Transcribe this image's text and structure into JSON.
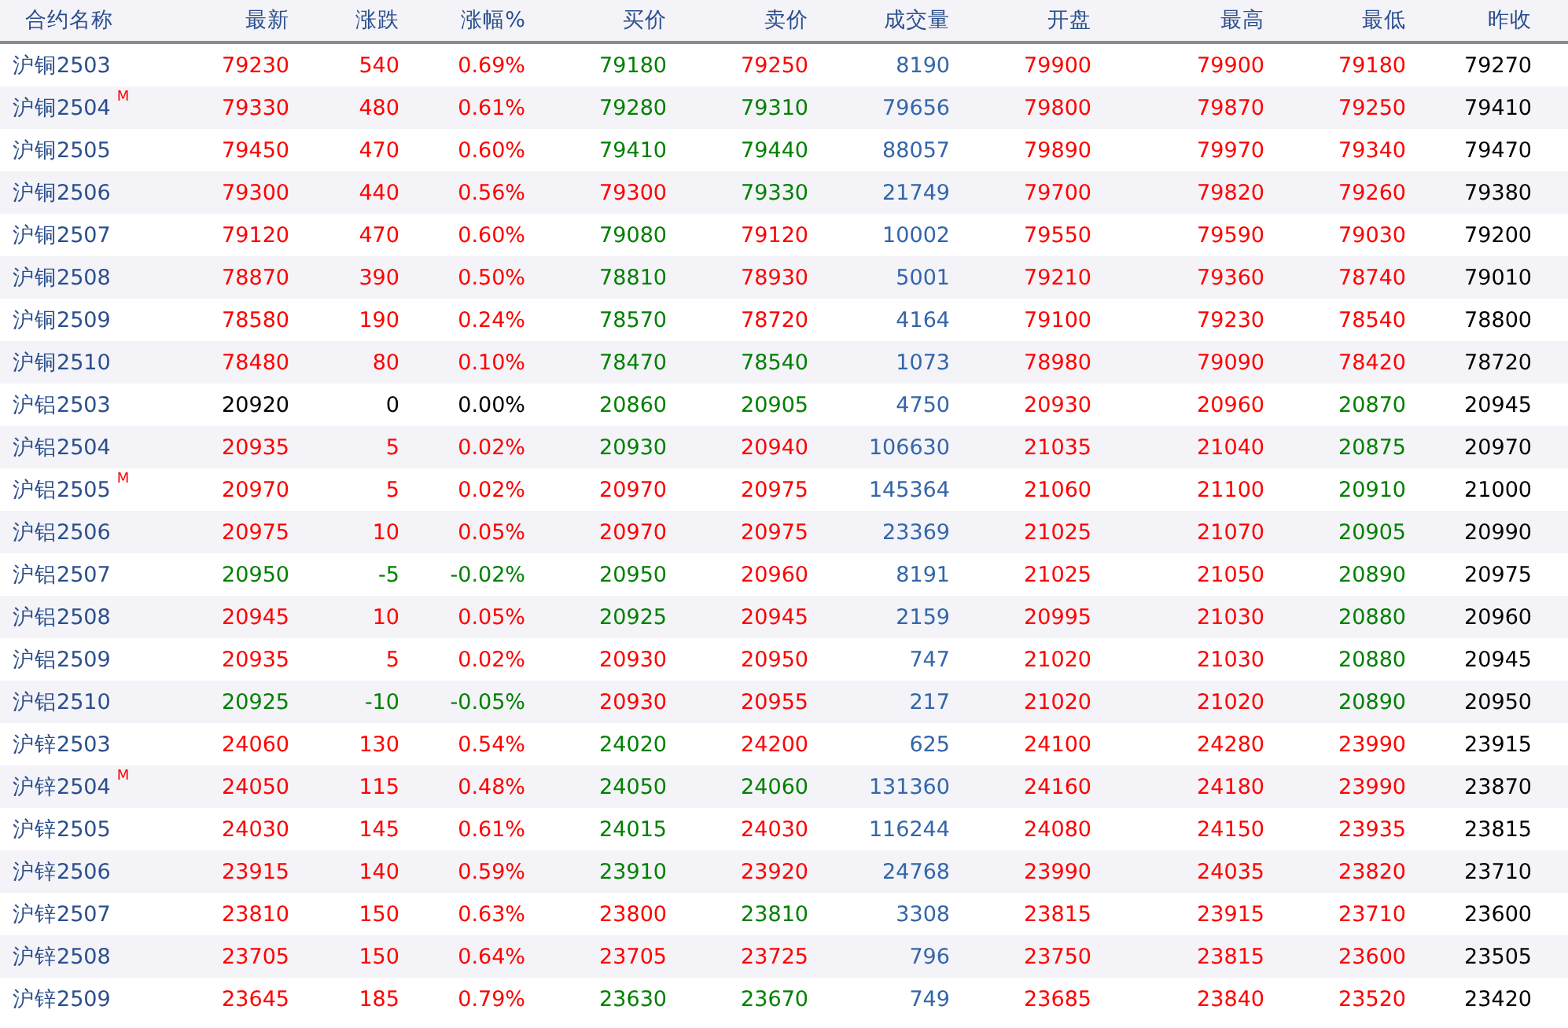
{
  "table": {
    "columns": [
      "合约名称",
      "最新",
      "涨跌",
      "涨幅%",
      "买价",
      "卖价",
      "成交量",
      "开盘",
      "最高",
      "最低",
      "昨收"
    ],
    "rows": [
      {
        "cells": [
          {
            "text": "沪铜2503"
          },
          {
            "text": "79230",
            "color": "#ff0000"
          },
          {
            "text": "540",
            "color": "#ff0000"
          },
          {
            "text": "0.69%",
            "color": "#ff0000"
          },
          {
            "text": "79180",
            "color": "#008000"
          },
          {
            "text": "79250",
            "color": "#ff0000"
          },
          {
            "text": "8190",
            "color": "#3366aa"
          },
          {
            "text": "79900",
            "color": "#ff0000"
          },
          {
            "text": "79900",
            "color": "#ff0000"
          },
          {
            "text": "79180",
            "color": "#ff0000"
          },
          {
            "text": "79270",
            "color": "#000000"
          }
        ]
      },
      {
        "cells": [
          {
            "text": "沪铜2504",
            "badge": "M"
          },
          {
            "text": "79330",
            "color": "#ff0000"
          },
          {
            "text": "480",
            "color": "#ff0000"
          },
          {
            "text": "0.61%",
            "color": "#ff0000"
          },
          {
            "text": "79280",
            "color": "#008000"
          },
          {
            "text": "79310",
            "color": "#008000"
          },
          {
            "text": "79656",
            "color": "#3366aa"
          },
          {
            "text": "79800",
            "color": "#ff0000"
          },
          {
            "text": "79870",
            "color": "#ff0000"
          },
          {
            "text": "79250",
            "color": "#ff0000"
          },
          {
            "text": "79410",
            "color": "#000000"
          }
        ]
      },
      {
        "cells": [
          {
            "text": "沪铜2505"
          },
          {
            "text": "79450",
            "color": "#ff0000"
          },
          {
            "text": "470",
            "color": "#ff0000"
          },
          {
            "text": "0.60%",
            "color": "#ff0000"
          },
          {
            "text": "79410",
            "color": "#008000"
          },
          {
            "text": "79440",
            "color": "#008000"
          },
          {
            "text": "88057",
            "color": "#3366aa"
          },
          {
            "text": "79890",
            "color": "#ff0000"
          },
          {
            "text": "79970",
            "color": "#ff0000"
          },
          {
            "text": "79340",
            "color": "#ff0000"
          },
          {
            "text": "79470",
            "color": "#000000"
          }
        ]
      },
      {
        "cells": [
          {
            "text": "沪铜2506"
          },
          {
            "text": "79300",
            "color": "#ff0000"
          },
          {
            "text": "440",
            "color": "#ff0000"
          },
          {
            "text": "0.56%",
            "color": "#ff0000"
          },
          {
            "text": "79300",
            "color": "#ff0000"
          },
          {
            "text": "79330",
            "color": "#008000"
          },
          {
            "text": "21749",
            "color": "#3366aa"
          },
          {
            "text": "79700",
            "color": "#ff0000"
          },
          {
            "text": "79820",
            "color": "#ff0000"
          },
          {
            "text": "79260",
            "color": "#ff0000"
          },
          {
            "text": "79380",
            "color": "#000000"
          }
        ]
      },
      {
        "cells": [
          {
            "text": "沪铜2507"
          },
          {
            "text": "79120",
            "color": "#ff0000"
          },
          {
            "text": "470",
            "color": "#ff0000"
          },
          {
            "text": "0.60%",
            "color": "#ff0000"
          },
          {
            "text": "79080",
            "color": "#008000"
          },
          {
            "text": "79120",
            "color": "#ff0000"
          },
          {
            "text": "10002",
            "color": "#3366aa"
          },
          {
            "text": "79550",
            "color": "#ff0000"
          },
          {
            "text": "79590",
            "color": "#ff0000"
          },
          {
            "text": "79030",
            "color": "#ff0000"
          },
          {
            "text": "79200",
            "color": "#000000"
          }
        ]
      },
      {
        "cells": [
          {
            "text": "沪铜2508"
          },
          {
            "text": "78870",
            "color": "#ff0000"
          },
          {
            "text": "390",
            "color": "#ff0000"
          },
          {
            "text": "0.50%",
            "color": "#ff0000"
          },
          {
            "text": "78810",
            "color": "#008000"
          },
          {
            "text": "78930",
            "color": "#ff0000"
          },
          {
            "text": "5001",
            "color": "#3366aa"
          },
          {
            "text": "79210",
            "color": "#ff0000"
          },
          {
            "text": "79360",
            "color": "#ff0000"
          },
          {
            "text": "78740",
            "color": "#ff0000"
          },
          {
            "text": "79010",
            "color": "#000000"
          }
        ]
      },
      {
        "cells": [
          {
            "text": "沪铜2509"
          },
          {
            "text": "78580",
            "color": "#ff0000"
          },
          {
            "text": "190",
            "color": "#ff0000"
          },
          {
            "text": "0.24%",
            "color": "#ff0000"
          },
          {
            "text": "78570",
            "color": "#008000"
          },
          {
            "text": "78720",
            "color": "#ff0000"
          },
          {
            "text": "4164",
            "color": "#3366aa"
          },
          {
            "text": "79100",
            "color": "#ff0000"
          },
          {
            "text": "79230",
            "color": "#ff0000"
          },
          {
            "text": "78540",
            "color": "#ff0000"
          },
          {
            "text": "78800",
            "color": "#000000"
          }
        ]
      },
      {
        "cells": [
          {
            "text": "沪铜2510"
          },
          {
            "text": "78480",
            "color": "#ff0000"
          },
          {
            "text": "80",
            "color": "#ff0000"
          },
          {
            "text": "0.10%",
            "color": "#ff0000"
          },
          {
            "text": "78470",
            "color": "#008000"
          },
          {
            "text": "78540",
            "color": "#008000"
          },
          {
            "text": "1073",
            "color": "#3366aa"
          },
          {
            "text": "78980",
            "color": "#ff0000"
          },
          {
            "text": "79090",
            "color": "#ff0000"
          },
          {
            "text": "78420",
            "color": "#ff0000"
          },
          {
            "text": "78720",
            "color": "#000000"
          }
        ]
      },
      {
        "cells": [
          {
            "text": "沪铝2503"
          },
          {
            "text": "20920",
            "color": "#000000"
          },
          {
            "text": "0",
            "color": "#000000"
          },
          {
            "text": "0.00%",
            "color": "#000000"
          },
          {
            "text": "20860",
            "color": "#008000"
          },
          {
            "text": "20905",
            "color": "#008000"
          },
          {
            "text": "4750",
            "color": "#3366aa"
          },
          {
            "text": "20930",
            "color": "#ff0000"
          },
          {
            "text": "20960",
            "color": "#ff0000"
          },
          {
            "text": "20870",
            "color": "#008000"
          },
          {
            "text": "20945",
            "color": "#000000"
          }
        ]
      },
      {
        "cells": [
          {
            "text": "沪铝2504"
          },
          {
            "text": "20935",
            "color": "#ff0000"
          },
          {
            "text": "5",
            "color": "#ff0000"
          },
          {
            "text": "0.02%",
            "color": "#ff0000"
          },
          {
            "text": "20930",
            "color": "#008000"
          },
          {
            "text": "20940",
            "color": "#ff0000"
          },
          {
            "text": "106630",
            "color": "#3366aa"
          },
          {
            "text": "21035",
            "color": "#ff0000"
          },
          {
            "text": "21040",
            "color": "#ff0000"
          },
          {
            "text": "20875",
            "color": "#008000"
          },
          {
            "text": "20970",
            "color": "#000000"
          }
        ]
      },
      {
        "cells": [
          {
            "text": "沪铝2505",
            "badge": "M"
          },
          {
            "text": "20970",
            "color": "#ff0000"
          },
          {
            "text": "5",
            "color": "#ff0000"
          },
          {
            "text": "0.02%",
            "color": "#ff0000"
          },
          {
            "text": "20970",
            "color": "#ff0000"
          },
          {
            "text": "20975",
            "color": "#ff0000"
          },
          {
            "text": "145364",
            "color": "#3366aa"
          },
          {
            "text": "21060",
            "color": "#ff0000"
          },
          {
            "text": "21100",
            "color": "#ff0000"
          },
          {
            "text": "20910",
            "color": "#008000"
          },
          {
            "text": "21000",
            "color": "#000000"
          }
        ]
      },
      {
        "cells": [
          {
            "text": "沪铝2506"
          },
          {
            "text": "20975",
            "color": "#ff0000"
          },
          {
            "text": "10",
            "color": "#ff0000"
          },
          {
            "text": "0.05%",
            "color": "#ff0000"
          },
          {
            "text": "20970",
            "color": "#ff0000"
          },
          {
            "text": "20975",
            "color": "#ff0000"
          },
          {
            "text": "23369",
            "color": "#3366aa"
          },
          {
            "text": "21025",
            "color": "#ff0000"
          },
          {
            "text": "21070",
            "color": "#ff0000"
          },
          {
            "text": "20905",
            "color": "#008000"
          },
          {
            "text": "20990",
            "color": "#000000"
          }
        ]
      },
      {
        "cells": [
          {
            "text": "沪铝2507"
          },
          {
            "text": "20950",
            "color": "#008000"
          },
          {
            "text": "-5",
            "color": "#008000"
          },
          {
            "text": "-0.02%",
            "color": "#008000"
          },
          {
            "text": "20950",
            "color": "#008000"
          },
          {
            "text": "20960",
            "color": "#ff0000"
          },
          {
            "text": "8191",
            "color": "#3366aa"
          },
          {
            "text": "21025",
            "color": "#ff0000"
          },
          {
            "text": "21050",
            "color": "#ff0000"
          },
          {
            "text": "20890",
            "color": "#008000"
          },
          {
            "text": "20975",
            "color": "#000000"
          }
        ]
      },
      {
        "cells": [
          {
            "text": "沪铝2508"
          },
          {
            "text": "20945",
            "color": "#ff0000"
          },
          {
            "text": "10",
            "color": "#ff0000"
          },
          {
            "text": "0.05%",
            "color": "#ff0000"
          },
          {
            "text": "20925",
            "color": "#008000"
          },
          {
            "text": "20945",
            "color": "#ff0000"
          },
          {
            "text": "2159",
            "color": "#3366aa"
          },
          {
            "text": "20995",
            "color": "#ff0000"
          },
          {
            "text": "21030",
            "color": "#ff0000"
          },
          {
            "text": "20880",
            "color": "#008000"
          },
          {
            "text": "20960",
            "color": "#000000"
          }
        ]
      },
      {
        "cells": [
          {
            "text": "沪铝2509"
          },
          {
            "text": "20935",
            "color": "#ff0000"
          },
          {
            "text": "5",
            "color": "#ff0000"
          },
          {
            "text": "0.02%",
            "color": "#ff0000"
          },
          {
            "text": "20930",
            "color": "#ff0000"
          },
          {
            "text": "20950",
            "color": "#ff0000"
          },
          {
            "text": "747",
            "color": "#3366aa"
          },
          {
            "text": "21020",
            "color": "#ff0000"
          },
          {
            "text": "21030",
            "color": "#ff0000"
          },
          {
            "text": "20880",
            "color": "#008000"
          },
          {
            "text": "20945",
            "color": "#000000"
          }
        ]
      },
      {
        "cells": [
          {
            "text": "沪铝2510"
          },
          {
            "text": "20925",
            "color": "#008000"
          },
          {
            "text": "-10",
            "color": "#008000"
          },
          {
            "text": "-0.05%",
            "color": "#008000"
          },
          {
            "text": "20930",
            "color": "#ff0000"
          },
          {
            "text": "20955",
            "color": "#ff0000"
          },
          {
            "text": "217",
            "color": "#3366aa"
          },
          {
            "text": "21020",
            "color": "#ff0000"
          },
          {
            "text": "21020",
            "color": "#ff0000"
          },
          {
            "text": "20890",
            "color": "#008000"
          },
          {
            "text": "20950",
            "color": "#000000"
          }
        ]
      },
      {
        "cells": [
          {
            "text": "沪锌2503"
          },
          {
            "text": "24060",
            "color": "#ff0000"
          },
          {
            "text": "130",
            "color": "#ff0000"
          },
          {
            "text": "0.54%",
            "color": "#ff0000"
          },
          {
            "text": "24020",
            "color": "#008000"
          },
          {
            "text": "24200",
            "color": "#ff0000"
          },
          {
            "text": "625",
            "color": "#3366aa"
          },
          {
            "text": "24100",
            "color": "#ff0000"
          },
          {
            "text": "24280",
            "color": "#ff0000"
          },
          {
            "text": "23990",
            "color": "#ff0000"
          },
          {
            "text": "23915",
            "color": "#000000"
          }
        ]
      },
      {
        "cells": [
          {
            "text": "沪锌2504",
            "badge": "M"
          },
          {
            "text": "24050",
            "color": "#ff0000"
          },
          {
            "text": "115",
            "color": "#ff0000"
          },
          {
            "text": "0.48%",
            "color": "#ff0000"
          },
          {
            "text": "24050",
            "color": "#008000"
          },
          {
            "text": "24060",
            "color": "#008000"
          },
          {
            "text": "131360",
            "color": "#3366aa"
          },
          {
            "text": "24160",
            "color": "#ff0000"
          },
          {
            "text": "24180",
            "color": "#ff0000"
          },
          {
            "text": "23990",
            "color": "#ff0000"
          },
          {
            "text": "23870",
            "color": "#000000"
          }
        ]
      },
      {
        "cells": [
          {
            "text": "沪锌2505"
          },
          {
            "text": "24030",
            "color": "#ff0000"
          },
          {
            "text": "145",
            "color": "#ff0000"
          },
          {
            "text": "0.61%",
            "color": "#ff0000"
          },
          {
            "text": "24015",
            "color": "#008000"
          },
          {
            "text": "24030",
            "color": "#ff0000"
          },
          {
            "text": "116244",
            "color": "#3366aa"
          },
          {
            "text": "24080",
            "color": "#ff0000"
          },
          {
            "text": "24150",
            "color": "#ff0000"
          },
          {
            "text": "23935",
            "color": "#ff0000"
          },
          {
            "text": "23815",
            "color": "#000000"
          }
        ]
      },
      {
        "cells": [
          {
            "text": "沪锌2506"
          },
          {
            "text": "23915",
            "color": "#ff0000"
          },
          {
            "text": "140",
            "color": "#ff0000"
          },
          {
            "text": "0.59%",
            "color": "#ff0000"
          },
          {
            "text": "23910",
            "color": "#008000"
          },
          {
            "text": "23920",
            "color": "#ff0000"
          },
          {
            "text": "24768",
            "color": "#3366aa"
          },
          {
            "text": "23990",
            "color": "#ff0000"
          },
          {
            "text": "24035",
            "color": "#ff0000"
          },
          {
            "text": "23820",
            "color": "#ff0000"
          },
          {
            "text": "23710",
            "color": "#000000"
          }
        ]
      },
      {
        "cells": [
          {
            "text": "沪锌2507"
          },
          {
            "text": "23810",
            "color": "#ff0000"
          },
          {
            "text": "150",
            "color": "#ff0000"
          },
          {
            "text": "0.63%",
            "color": "#ff0000"
          },
          {
            "text": "23800",
            "color": "#ff0000"
          },
          {
            "text": "23810",
            "color": "#008000"
          },
          {
            "text": "3308",
            "color": "#3366aa"
          },
          {
            "text": "23815",
            "color": "#ff0000"
          },
          {
            "text": "23915",
            "color": "#ff0000"
          },
          {
            "text": "23710",
            "color": "#ff0000"
          },
          {
            "text": "23600",
            "color": "#000000"
          }
        ]
      },
      {
        "cells": [
          {
            "text": "沪锌2508"
          },
          {
            "text": "23705",
            "color": "#ff0000"
          },
          {
            "text": "150",
            "color": "#ff0000"
          },
          {
            "text": "0.64%",
            "color": "#ff0000"
          },
          {
            "text": "23705",
            "color": "#ff0000"
          },
          {
            "text": "23725",
            "color": "#ff0000"
          },
          {
            "text": "796",
            "color": "#3366aa"
          },
          {
            "text": "23750",
            "color": "#ff0000"
          },
          {
            "text": "23815",
            "color": "#ff0000"
          },
          {
            "text": "23600",
            "color": "#ff0000"
          },
          {
            "text": "23505",
            "color": "#000000"
          }
        ]
      },
      {
        "cells": [
          {
            "text": "沪锌2509"
          },
          {
            "text": "23645",
            "color": "#ff0000"
          },
          {
            "text": "185",
            "color": "#ff0000"
          },
          {
            "text": "0.79%",
            "color": "#ff0000"
          },
          {
            "text": "23630",
            "color": "#008000"
          },
          {
            "text": "23670",
            "color": "#008000"
          },
          {
            "text": "749",
            "color": "#3366aa"
          },
          {
            "text": "23685",
            "color": "#ff0000"
          },
          {
            "text": "23840",
            "color": "#ff0000"
          },
          {
            "text": "23520",
            "color": "#ff0000"
          },
          {
            "text": "23420",
            "color": "#000000"
          }
        ]
      }
    ]
  }
}
